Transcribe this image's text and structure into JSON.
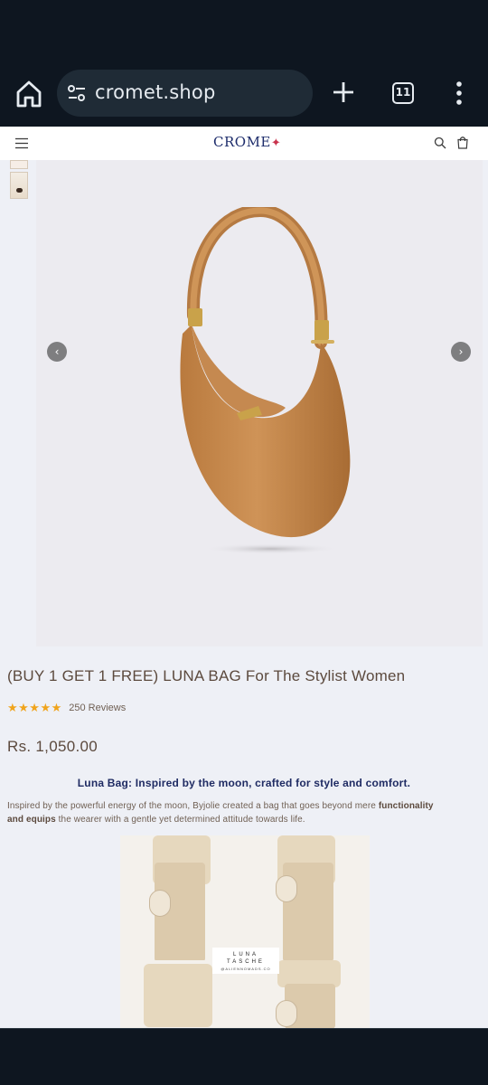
{
  "browser": {
    "url": "cromet.shop",
    "tab_count": "11",
    "icons": [
      "home-icon",
      "site-settings-icon",
      "new-tab-icon",
      "tab-switcher-icon",
      "overflow-menu-icon"
    ]
  },
  "site": {
    "logo": "CROME",
    "logo_mark": "✦",
    "icons": [
      "hamburger-icon",
      "search-icon",
      "cart-icon"
    ]
  },
  "product": {
    "title": "(BUY 1 GET 1 FREE) LUNA BAG For The Stylist Women",
    "stars": "★★★★★",
    "rating": 5,
    "reviews": "250 Reviews",
    "price": "Rs. 1,050.00",
    "tagline": "Luna Bag: Inspired by the moon, crafted for style and comfort.",
    "desc_part1": "Inspired by the powerful energy of the moon, Byjolie created a bag that goes beyond mere ",
    "desc_bold": "functionality and equips",
    "desc_part2": " the wearer with a gentle yet determined attitude towards life."
  },
  "gallery": {
    "prev_glyph": "‹",
    "next_glyph": "›"
  },
  "collage": {
    "line1": "LUNA",
    "line2": "TASCHE",
    "line3": "@ALIENNOMADS.CO"
  },
  "colors": {
    "accent": "#1f2b63",
    "text": "#5c4a3e",
    "star": "#f0a41c",
    "bag": "#c98d52"
  }
}
